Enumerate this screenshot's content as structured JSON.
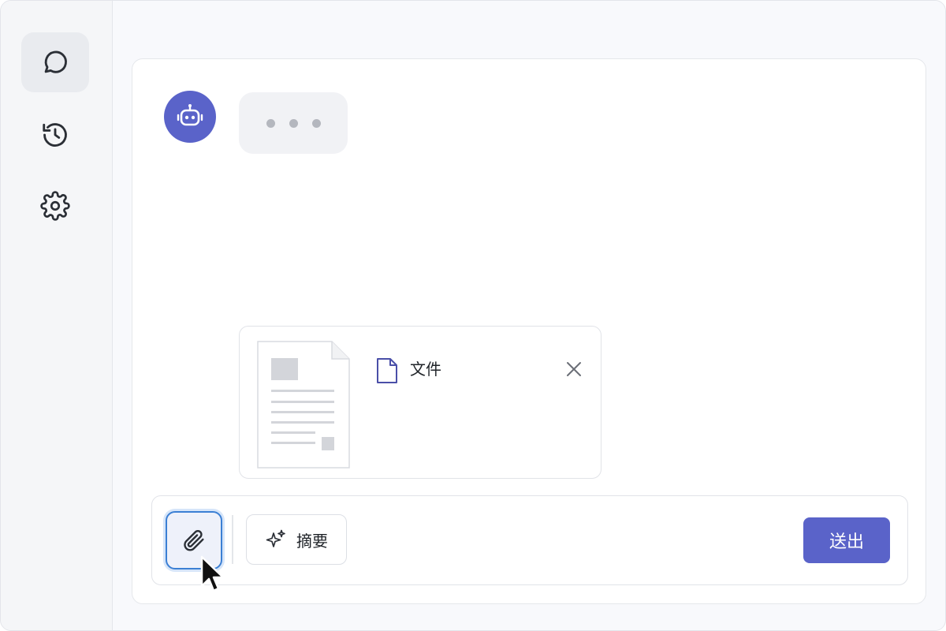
{
  "sidebar": {
    "items": [
      {
        "icon": "chat-bubble-icon",
        "active": true
      },
      {
        "icon": "history-icon",
        "active": false
      },
      {
        "icon": "gear-icon",
        "active": false
      }
    ]
  },
  "chat": {
    "assistant_avatar_icon": "robot-icon",
    "typing_indicator": "..."
  },
  "attachment": {
    "file_name": "文件",
    "file_icon": "file-icon",
    "remove_icon": "close-icon"
  },
  "composer": {
    "attach_icon": "paperclip-icon",
    "summary_label": "摘要",
    "summary_icon": "sparkles-icon",
    "send_label": "送出"
  },
  "colors": {
    "accent": "#5a63c9",
    "focus_ring": "#3b7fd4",
    "sidebar_bg": "#f5f6f8"
  }
}
